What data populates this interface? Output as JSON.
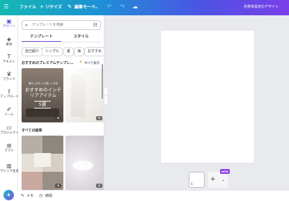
{
  "topbar": {
    "file": "ファイル",
    "resize": "リサイズ",
    "edit_mode": "編集モード",
    "doc_title": "名称未設定のデザイン"
  },
  "rail": [
    {
      "label": "デザイン",
      "icon": "design-icon"
    },
    {
      "label": "素材",
      "icon": "elements-icon"
    },
    {
      "label": "テキスト",
      "icon": "text-icon"
    },
    {
      "label": "ブランド",
      "icon": "brand-icon"
    },
    {
      "label": "アップロード",
      "icon": "upload-icon"
    },
    {
      "label": "ツール",
      "icon": "tools-icon"
    },
    {
      "label": "プロジェクト",
      "icon": "project-icon"
    },
    {
      "label": "アプリ",
      "icon": "apps-icon"
    },
    {
      "label": "マジック生成",
      "icon": "magic-icon"
    }
  ],
  "panel": {
    "search_placeholder": "テンプレートを検索",
    "tabs": [
      "テンプレート",
      "スタイル"
    ],
    "chips": [
      "自己紹介",
      "シンプル",
      "夏",
      "海",
      "おすすめ"
    ],
    "premium_title": "おすすめのプレミアムテンプレ…",
    "see_all": "すべて表示",
    "all_results": "すべての結果",
    "template1": {
      "small": "暮らしがもっと楽しくなる",
      "headline": "おすすめのインテリアアイテム",
      "count": "5選"
    }
  },
  "canvas": {
    "page_number": "1",
    "new_badge": "NEW"
  },
  "bottombar": {
    "notes": "メモ",
    "timer": "時間"
  }
}
